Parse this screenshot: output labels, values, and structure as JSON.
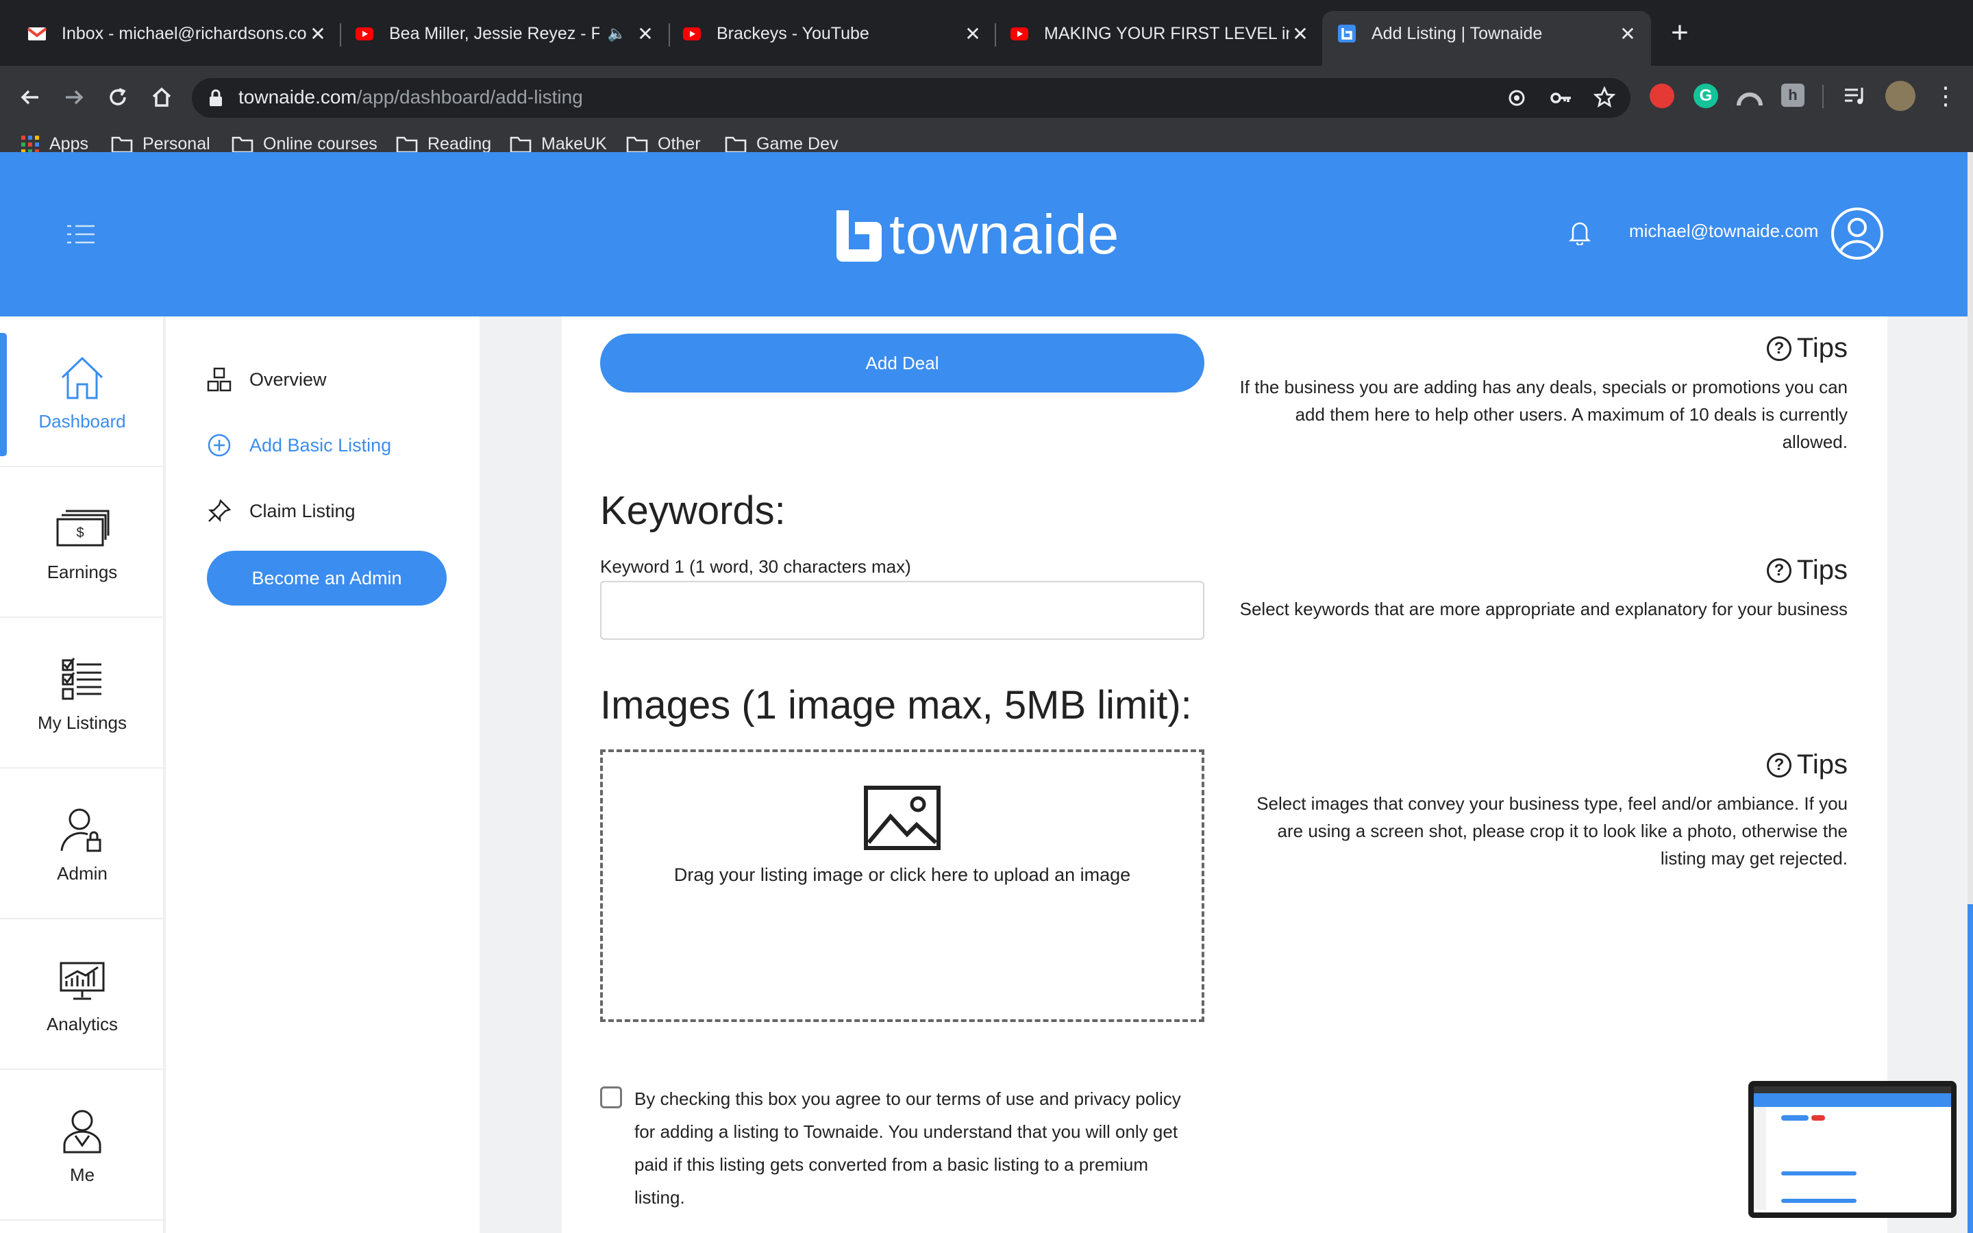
{
  "browser": {
    "tabs": [
      {
        "title": "Inbox - michael@richardsons.co",
        "favicon": "gmail-icon"
      },
      {
        "title": "Bea Miller, Jessie Reyez - FE",
        "favicon": "youtube-icon",
        "audio": true
      },
      {
        "title": "Brackeys - YouTube",
        "favicon": "youtube-icon"
      },
      {
        "title": "MAKING YOUR FIRST LEVEL in U",
        "favicon": "youtube-icon"
      },
      {
        "title": "Add Listing | Townaide",
        "favicon": "townaide-icon",
        "active": true
      }
    ],
    "url_host": "townaide.com",
    "url_path": "/app/dashboard/add-listing",
    "bookmarks": [
      "Apps",
      "Personal",
      "Online courses",
      "Reading",
      "MakeUK",
      "Other",
      "Game Dev"
    ]
  },
  "header": {
    "brand": "townaide",
    "user_email": "michael@townaide.com",
    "color": "#3b8def"
  },
  "rail": {
    "items": [
      {
        "label": "Dashboard",
        "icon": "house-icon",
        "active": true
      },
      {
        "label": "Earnings",
        "icon": "money-icon"
      },
      {
        "label": "My Listings",
        "icon": "checklist-icon"
      },
      {
        "label": "Admin",
        "icon": "admin-user-icon"
      },
      {
        "label": "Analytics",
        "icon": "analytics-monitor-icon"
      },
      {
        "label": "Me",
        "icon": "person-icon"
      }
    ]
  },
  "submenu": {
    "overview": "Overview",
    "add_basic": "Add Basic Listing",
    "claim": "Claim Listing",
    "become_admin": "Become an Admin"
  },
  "form": {
    "add_deal": "Add Deal",
    "keywords_heading": "Keywords:",
    "keyword1_label": "Keyword 1 (1 word, 30 characters max)",
    "keyword1_value": "",
    "images_heading": "Images (1 image max, 5MB limit):",
    "dropzone_text": "Drag your listing image or click here to upload an image",
    "agree_text": "By checking this box you agree to our terms of use and privacy policy for adding a listing to Townaide. You understand that you will only get paid if this listing gets converted from a basic listing to a premium listing.",
    "agree_checked": false
  },
  "tips": {
    "label": "Tips",
    "deals": "If the business you are adding has any deals, specials or promotions you can add them here to help other users. A maximum of 10 deals is currently allowed.",
    "keywords": "Select keywords that are more appropriate and explanatory for your business",
    "images": "Select images that convey your business type, feel and/or ambiance. If you are using a screen shot, please crop it to look like a photo, otherwise the listing may get rejected."
  }
}
